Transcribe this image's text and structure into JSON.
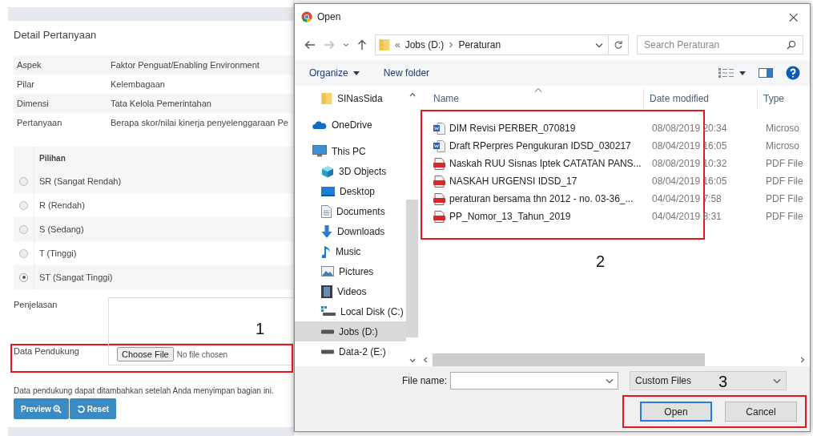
{
  "page": {
    "title": "Detail Pertanyaan",
    "details": [
      {
        "label": "Aspek",
        "value": "Faktor Penguat/Enabling Environment"
      },
      {
        "label": "Pilar",
        "value": "Kelembagaan"
      },
      {
        "label": "Dimensi",
        "value": "Tata Kelola Pemerintahan"
      },
      {
        "label": "Pertanyaan",
        "value": "Berapa skor/nilai kinerja penyelenggaraan Pe"
      }
    ],
    "options_header": "Pilihan",
    "options": [
      {
        "label": "SR (Sangat Rendah)",
        "selected": false
      },
      {
        "label": "R (Rendah)",
        "selected": false
      },
      {
        "label": "S (Sedang)",
        "selected": false
      },
      {
        "label": "T (Tinggi)",
        "selected": false
      },
      {
        "label": "ST (Sangat Tinggi)",
        "selected": true
      }
    ],
    "explanation_label": "Penjelasan",
    "support_label": "Data Pendukung",
    "file_button": "Choose File",
    "file_status": "No file chosen",
    "note": "Data pendukung dapat ditambahkan setelah Anda menyimpan bagian ini.",
    "buttons": [
      {
        "label": "Preview",
        "kind": "preview"
      },
      {
        "label": "Reset",
        "kind": "reset"
      }
    ]
  },
  "dialog": {
    "title": "Open",
    "close": "×",
    "address": {
      "overflow_mark": "«",
      "path": [
        "Jobs (D:)",
        "Peraturan"
      ]
    },
    "search": {
      "placeholder": "Search Peraturan"
    },
    "toolbar": {
      "organize": "Organize",
      "new_folder": "New folder"
    },
    "nav": [
      {
        "label": "SINasSida",
        "kind": "folder",
        "selected": false
      },
      {
        "label": "OneDrive",
        "kind": "cloud",
        "selected": false
      },
      {
        "label": "This PC",
        "kind": "pc",
        "selected": false,
        "children": [
          {
            "label": "3D Objects",
            "kind": "cube",
            "selected": false
          },
          {
            "label": "Desktop",
            "kind": "desktop",
            "selected": false
          },
          {
            "label": "Documents",
            "kind": "documents",
            "selected": false
          },
          {
            "label": "Downloads",
            "kind": "downloads",
            "selected": false
          },
          {
            "label": "Music",
            "kind": "music",
            "selected": false
          },
          {
            "label": "Pictures",
            "kind": "pictures",
            "selected": false
          },
          {
            "label": "Videos",
            "kind": "videos",
            "selected": false
          },
          {
            "label": "Local Disk (C:)",
            "kind": "system_drive",
            "selected": false
          },
          {
            "label": "Jobs (D:)",
            "kind": "drive",
            "selected": true
          },
          {
            "label": "Data-2 (E:)",
            "kind": "drive",
            "selected": false
          }
        ]
      }
    ],
    "columns": [
      "Name",
      "Date modified",
      "Type"
    ],
    "files": [
      {
        "name": "DIM Revisi PERBER_070819",
        "date": "08/08/2019 20:34",
        "type": "Microso",
        "kind": "word"
      },
      {
        "name": "Draft RPerpres Pengukuran IDSD_030217",
        "date": "08/04/2019 16:05",
        "type": "Microso",
        "kind": "word"
      },
      {
        "name": "Naskah RUU Sisnas Iptek CATATAN PANS...",
        "date": "08/08/2019 10:32",
        "type": "PDF File",
        "kind": "pdf"
      },
      {
        "name": "NASKAH URGENSI IDSD_17",
        "date": "08/04/2019 16:05",
        "type": "PDF File",
        "kind": "pdf"
      },
      {
        "name": "peraturan bersama thn 2012 - no. 03-36_...",
        "date": "04/04/2019 7:58",
        "type": "PDF File",
        "kind": "pdf"
      },
      {
        "name": "PP_Nomor_13_Tahun_2019",
        "date": "04/04/2019 8:31",
        "type": "PDF File",
        "kind": "pdf"
      }
    ],
    "file_name_label": "File name:",
    "file_type": "Custom Files",
    "buttons": [
      {
        "label": "Open",
        "kind": "default"
      },
      {
        "label": "Cancel",
        "kind": "normal"
      }
    ]
  },
  "callouts": {
    "support_row": "1",
    "file_list": "2",
    "dialog_buttons": "3"
  }
}
